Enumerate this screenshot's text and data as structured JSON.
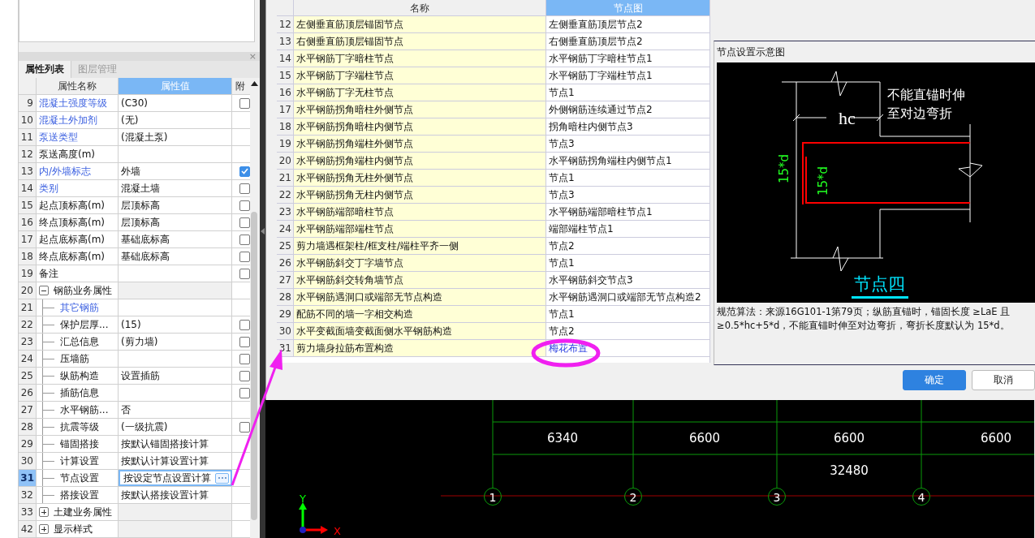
{
  "property_panel": {
    "close": "×",
    "tabs": [
      {
        "label": "属性列表",
        "selected": true
      },
      {
        "label": "图层管理",
        "selected": false
      }
    ],
    "columns": [
      "属性名称",
      "属性值",
      "附"
    ],
    "rows": [
      {
        "num": "9",
        "name": "混凝土强度等级",
        "value": "(C30)",
        "public": true,
        "checked": false
      },
      {
        "num": "10",
        "name": "混凝土外加剂",
        "value": "(无)",
        "public": true
      },
      {
        "num": "11",
        "name": "泵送类型",
        "value": "(混凝土泵)",
        "public": true
      },
      {
        "num": "12",
        "name": "泵送高度(m)",
        "public": false
      },
      {
        "num": "13",
        "name": "内/外墙标志",
        "value": "外墙",
        "public": true,
        "checked": true
      },
      {
        "num": "14",
        "name": "类别",
        "value": "混凝土墙",
        "public": true,
        "checked": false
      },
      {
        "num": "15",
        "name": "起点顶标高(m)",
        "value": "层顶标高",
        "public": false,
        "checked": false
      },
      {
        "num": "16",
        "name": "终点顶标高(m)",
        "value": "层顶标高",
        "public": false,
        "checked": false
      },
      {
        "num": "17",
        "name": "起点底标高(m)",
        "value": "基础底标高",
        "public": false,
        "checked": false
      },
      {
        "num": "18",
        "name": "终点底标高(m)",
        "value": "基础底标高",
        "public": false,
        "checked": false
      },
      {
        "num": "19",
        "name": "备注",
        "public": false,
        "checked": false
      },
      {
        "num": "20",
        "name": "钢筋业务属性",
        "kind": "group",
        "expanded": true,
        "children": [
          {
            "num": "21",
            "name": "其它钢筋",
            "public": true
          },
          {
            "num": "22",
            "name": "保护层厚...",
            "value": "(15)",
            "public": false,
            "checked": false
          },
          {
            "num": "23",
            "name": "汇总信息",
            "value": "(剪力墙)",
            "public": false,
            "checked": false
          },
          {
            "num": "24",
            "name": "压墙筋",
            "public": false,
            "checked": false
          },
          {
            "num": "25",
            "name": "纵筋构造",
            "value": "设置插筋",
            "public": false,
            "checked": false
          },
          {
            "num": "26",
            "name": "插筋信息",
            "public": false,
            "checked": false
          },
          {
            "num": "27",
            "name": "水平钢筋...",
            "value": "否",
            "public": false
          },
          {
            "num": "28",
            "name": "抗震等级",
            "value": "(一级抗震)",
            "public": false,
            "checked": false
          },
          {
            "num": "29",
            "name": "锚固搭接",
            "value": "按默认锚固搭接计算",
            "public": false
          },
          {
            "num": "30",
            "name": "计算设置",
            "value": "按默认计算设置计算",
            "public": false
          },
          {
            "num": "31",
            "name": "节点设置",
            "value": "按设定节点设置计算",
            "public": false,
            "selected": true
          },
          {
            "num": "32",
            "name": "搭接设置",
            "value": "按默认搭接设置计算",
            "public": false
          }
        ]
      },
      {
        "num": "33",
        "name": "土建业务属性",
        "kind": "group",
        "expanded": false
      },
      {
        "num": "42",
        "name": "显示样式",
        "kind": "group",
        "expanded": false
      }
    ]
  },
  "node_dialog": {
    "columns": [
      "名称",
      "节点图"
    ],
    "rows": [
      {
        "num": "12",
        "name": "左侧垂直筋顶层锚固节点",
        "node": "左侧垂直筋顶层节点2"
      },
      {
        "num": "13",
        "name": "右侧垂直筋顶层锚固节点",
        "node": "右侧垂直筋顶层节点2"
      },
      {
        "num": "14",
        "name": "水平钢筋丁字暗柱节点",
        "node": "水平钢筋丁字暗柱节点1"
      },
      {
        "num": "15",
        "name": "水平钢筋丁字端柱节点",
        "node": "水平钢筋丁字端柱节点1"
      },
      {
        "num": "16",
        "name": "水平钢筋丁字无柱节点",
        "node": "节点1"
      },
      {
        "num": "17",
        "name": "水平钢筋拐角暗柱外侧节点",
        "node": "外侧钢筋连续通过节点2"
      },
      {
        "num": "18",
        "name": "水平钢筋拐角暗柱内侧节点",
        "node": "拐角暗柱内侧节点3"
      },
      {
        "num": "19",
        "name": "水平钢筋拐角端柱外侧节点",
        "node": "节点3"
      },
      {
        "num": "20",
        "name": "水平钢筋拐角端柱内侧节点",
        "node": "水平钢筋拐角端柱内侧节点1"
      },
      {
        "num": "21",
        "name": "水平钢筋拐角无柱外侧节点",
        "node": "节点1"
      },
      {
        "num": "22",
        "name": "水平钢筋拐角无柱内侧节点",
        "node": "节点3"
      },
      {
        "num": "23",
        "name": "水平钢筋端部暗柱节点",
        "node": "水平钢筋端部暗柱节点1"
      },
      {
        "num": "24",
        "name": "水平钢筋端部端柱节点",
        "node": "端部端柱节点1"
      },
      {
        "num": "25",
        "name": "剪力墙遇框架柱/框支柱/端柱平齐一侧",
        "node": "节点2"
      },
      {
        "num": "26",
        "name": "水平钢筋斜交丁字墙节点",
        "node": "节点1"
      },
      {
        "num": "27",
        "name": "水平钢筋斜交转角墙节点",
        "node": "水平钢筋斜交节点3"
      },
      {
        "num": "28",
        "name": "水平钢筋遇洞口或端部无节点构造",
        "node": "水平钢筋遇洞口或端部无节点构造2"
      },
      {
        "num": "29",
        "name": "配筋不同的墙一字相交构造",
        "node": "节点1"
      },
      {
        "num": "30",
        "name": "水平变截面墙变截面侧水平钢筋构造",
        "node": "节点2"
      },
      {
        "num": "31",
        "name": "剪力墙身拉筋布置构造",
        "node": "梅花布置",
        "link": true
      }
    ],
    "preview": {
      "title": "节点设置示意图",
      "note": [
        "不能直锚时伸",
        "至对边弯折"
      ],
      "width_label": "hc",
      "outer_length": "15*d",
      "inner_length": "15*d",
      "caption": "节点四",
      "description": "规范算法：来源16G101-1第79页；纵筋直锚时，锚固长度 ≥LaE 且≥0.5*hc+5*d，不能直锚时伸至对边弯折，弯折长度默认为 15*d。"
    },
    "buttons": [
      {
        "label": "确定",
        "kind": "primary"
      },
      {
        "label": "取消",
        "kind": "secondary"
      }
    ]
  },
  "drawing": {
    "spans": [
      "6340",
      "6600",
      "6600",
      "6600"
    ],
    "total": "32480",
    "axes": [
      "1",
      "2",
      "3",
      "4"
    ],
    "axis_y": "Y",
    "axis_x": "X"
  }
}
